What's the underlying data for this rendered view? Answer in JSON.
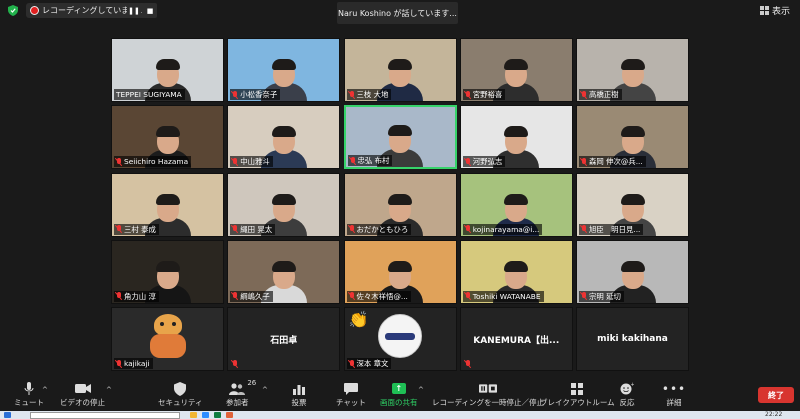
{
  "topbar": {
    "recording_label": "レコーディングしています...",
    "pause_glyph": "❚❚",
    "stop_glyph": "■",
    "speaker_text": "Naru  Koshino が話しています...",
    "view_label": "表示"
  },
  "participants": [
    {
      "name": "TEPPEI SUGIYAMA",
      "muted": false,
      "bg": "#cfd3d6",
      "shirt": "#2a2a2a",
      "active": false
    },
    {
      "name": "小松香奈子",
      "muted": true,
      "bg": "#7fb6e0",
      "shirt": "#3a3f4a",
      "active": false
    },
    {
      "name": "三枝 大地",
      "muted": true,
      "bg": "#c4b59a",
      "shirt": "#1f2a44",
      "active": false
    },
    {
      "name": "宮野裕喜",
      "muted": true,
      "bg": "#8a7d6e",
      "shirt": "#2d2d2d",
      "active": false
    },
    {
      "name": "高橋正樹",
      "muted": true,
      "bg": "#b8b3ac",
      "shirt": "#444444",
      "active": false
    },
    {
      "name": "Seiichiro Hazama",
      "muted": true,
      "bg": "#5a4634",
      "shirt": "#1c1c1c",
      "active": false
    },
    {
      "name": "中山雅斗",
      "muted": true,
      "bg": "#d7cdbf",
      "shirt": "#2b3a55",
      "active": false
    },
    {
      "name": "忠弘 布村",
      "muted": true,
      "bg": "#a9b8c9",
      "shirt": "#3b3b3b",
      "active": true
    },
    {
      "name": "河野弘志",
      "muted": true,
      "bg": "#e6e6e6",
      "shirt": "#2f2f2f",
      "active": false
    },
    {
      "name": "森岡 伸次@兵...",
      "muted": true,
      "bg": "#9a8a74",
      "shirt": "#2a2e38",
      "active": false
    },
    {
      "name": "三村 泰成",
      "muted": true,
      "bg": "#d5c2a2",
      "shirt": "#2c2c2c",
      "active": false
    },
    {
      "name": "縄田 晃太",
      "muted": true,
      "bg": "#cfc7bd",
      "shirt": "#3d3d3d",
      "active": false
    },
    {
      "name": "おだかともひろ",
      "muted": true,
      "bg": "#bfa78c",
      "shirt": "#2a2a2a",
      "active": false
    },
    {
      "name": "kojinarayama@i...",
      "muted": true,
      "bg": "#a6c27d",
      "shirt": "#1f2b4a",
      "active": false
    },
    {
      "name": "旭臣　明日見...",
      "muted": true,
      "bg": "#d9d2c5",
      "shirt": "#444444",
      "active": false
    },
    {
      "name": "角力山 淳",
      "muted": true,
      "bg": "#2a2620",
      "shirt": "#151515",
      "active": false
    },
    {
      "name": "綱嶋久子",
      "muted": true,
      "bg": "#7d6a58",
      "shirt": "#d9d9d9",
      "active": false
    },
    {
      "name": "佐々木祥悟@...",
      "muted": true,
      "bg": "#e0a25a",
      "shirt": "#1a1a1a",
      "active": false
    },
    {
      "name": "Toshiki WATANABE",
      "muted": true,
      "bg": "#d6c97d",
      "shirt": "#2a2a2a",
      "active": false
    },
    {
      "name": "宗明 延切",
      "muted": true,
      "bg": "#b8b8b8",
      "shirt": "#222222",
      "active": false
    },
    {
      "name": "kajikaji",
      "muted": true,
      "bg": "#2a2a2a",
      "shirt": "#e07b39",
      "active": false,
      "avatar": true
    },
    {
      "name": "石田卓",
      "muted": true,
      "bg": "#232323",
      "blank": true
    },
    {
      "name": "深本 章文",
      "muted": true,
      "bg": "#232323",
      "ball": true,
      "reaction": "👏"
    },
    {
      "name": "KANEMURA【出...",
      "muted": true,
      "bg": "#232323",
      "blank": true
    },
    {
      "name": "miki kakihana",
      "muted": false,
      "bg": "#232323",
      "blank": true
    }
  ],
  "toolbar": {
    "mute": "ミュート",
    "video": "ビデオの停止",
    "security": "セキュリティ",
    "participants": "参加者",
    "participants_count": "26",
    "poll": "投票",
    "chat": "チャット",
    "share": "画面の共有",
    "recording": "レコーディングを一時停止／停止",
    "breakout": "ブレイクアウトルーム",
    "reaction": "反応",
    "more": "詳細",
    "end": "終了"
  },
  "taskbar": {
    "clock": "22:22"
  },
  "colors": {
    "accent_green": "#36d36a",
    "end_red": "#d8352f",
    "share_green": "#1fbf55"
  }
}
